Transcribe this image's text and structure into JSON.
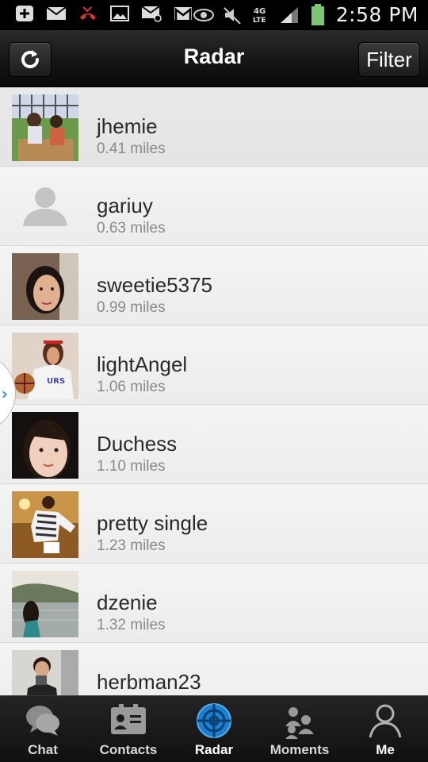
{
  "status_bar": {
    "time": "2:58 PM",
    "network": "4G LTE",
    "icons": [
      "add-icon",
      "mail-icon",
      "missed-call-icon",
      "image-icon",
      "email-icon",
      "gmail-icon",
      "eye-icon",
      "mute-icon",
      "4g-lte-icon",
      "signal-icon",
      "battery-icon"
    ]
  },
  "header": {
    "title": "Radar",
    "filter_label": "Filter",
    "refresh_icon": "refresh-icon"
  },
  "people": [
    {
      "name": "jhemie",
      "distance": "0.41 miles",
      "avatar": "photo"
    },
    {
      "name": "gariuy",
      "distance": "0.63 miles",
      "avatar": "default"
    },
    {
      "name": "sweetie5375",
      "distance": "0.99 miles",
      "avatar": "photo"
    },
    {
      "name": "lightAngel",
      "distance": "1.06 miles",
      "avatar": "photo"
    },
    {
      "name": "Duchess",
      "distance": "1.10 miles",
      "avatar": "photo"
    },
    {
      "name": "pretty single",
      "distance": "1.23 miles",
      "avatar": "photo"
    },
    {
      "name": "dzenie",
      "distance": "1.32 miles",
      "avatar": "photo"
    },
    {
      "name": "herbman23",
      "distance": "",
      "avatar": "photo"
    }
  ],
  "tabs": [
    {
      "label": "Chat",
      "icon": "chat-icon"
    },
    {
      "label": "Contacts",
      "icon": "contacts-icon"
    },
    {
      "label": "Radar",
      "icon": "radar-icon"
    },
    {
      "label": "Moments",
      "icon": "moments-icon"
    },
    {
      "label": "Me",
      "icon": "me-icon"
    }
  ],
  "colors": {
    "accent_blue": "#2f8ed8",
    "header_bg": "#151515",
    "list_bg": "#f2f2f2"
  }
}
